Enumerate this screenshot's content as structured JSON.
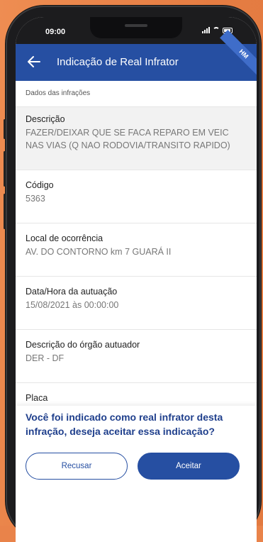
{
  "status_bar": {
    "time": "09:00"
  },
  "app_bar": {
    "title": "Indicação de Real Infrator",
    "ribbon": "HM"
  },
  "section": {
    "title": "Dados das infrações"
  },
  "fields": [
    {
      "label": "Descrição",
      "value": "FAZER/DEIXAR QUE SE FACA REPARO EM VEIC NAS VIAS (Q NAO RODOVIA/TRANSITO RAPIDO)"
    },
    {
      "label": "Código",
      "value": "5363"
    },
    {
      "label": "Local de ocorrência",
      "value": "AV. DO CONTORNO km 7 GUARÁ II"
    },
    {
      "label": "Data/Hora da autuação",
      "value": "15/08/2021 às 00:00:00"
    },
    {
      "label": "Descrição do órgão autuador",
      "value": "DER - DF"
    },
    {
      "label": "Placa",
      "value": ""
    }
  ],
  "confirmation": {
    "question": "Você foi indicado como real infrator desta infração, deseja aceitar essa indicação?",
    "refuse_label": "Recusar",
    "accept_label": "Aceitar"
  },
  "colors": {
    "primary": "#264fa2",
    "background": "#e9834a",
    "question_text": "#1f3f8c"
  }
}
